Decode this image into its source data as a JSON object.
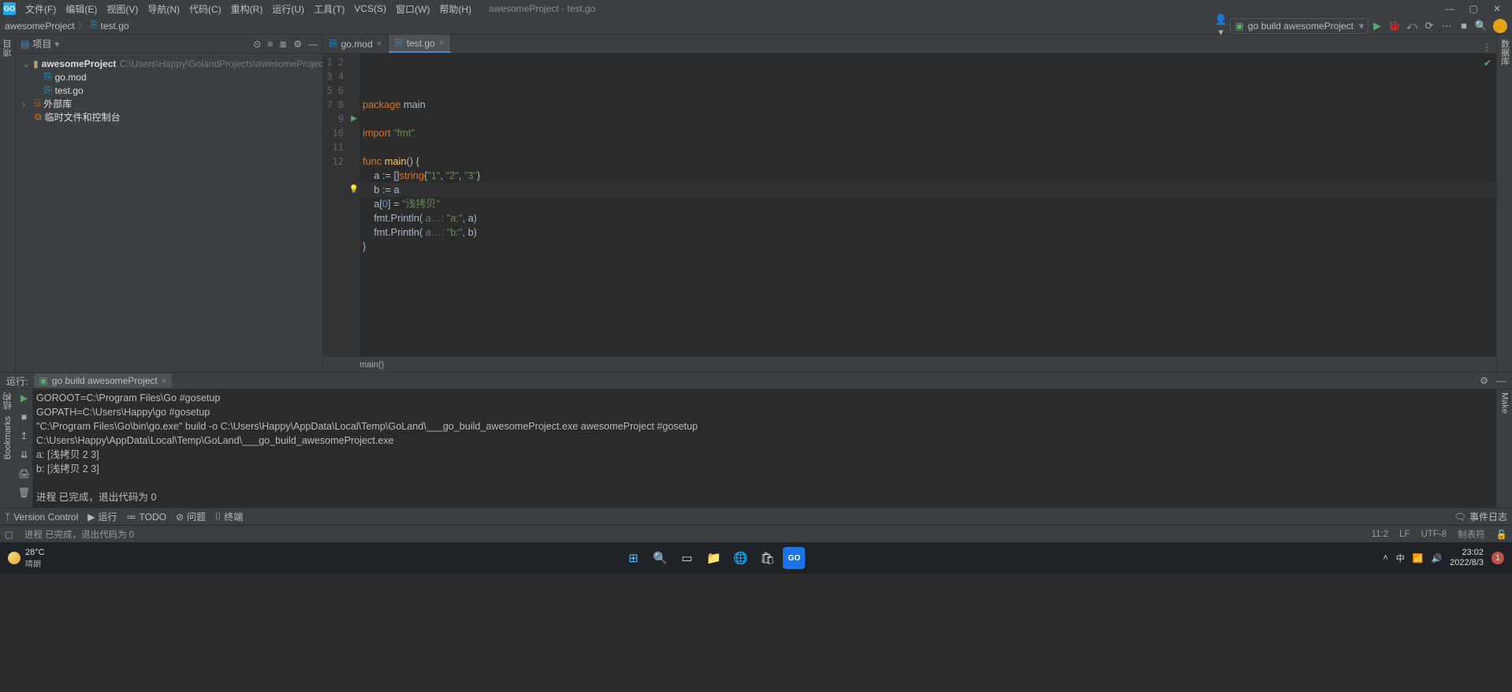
{
  "window": {
    "title": "awesomeProject - test.go",
    "menus": [
      "文件(F)",
      "编辑(E)",
      "视图(V)",
      "导航(N)",
      "代码(C)",
      "重构(R)",
      "运行(U)",
      "工具(T)",
      "VCS(S)",
      "窗口(W)",
      "帮助(H)"
    ]
  },
  "breadcrumb": {
    "project": "awesomeProject",
    "file": "test.go"
  },
  "run_config": {
    "label": "go build awesomeProject"
  },
  "project_panel": {
    "title": "项目",
    "root": {
      "name": "awesomeProject",
      "path": "C:\\Users\\Happy\\GolandProjects\\awesomeProject"
    },
    "files": [
      {
        "name": "go.mod"
      },
      {
        "name": "test.go"
      }
    ],
    "ext_lib": "外部库",
    "scratches": "临时文件和控制台"
  },
  "left_vtabs": [
    "项目"
  ],
  "right_vtabs": [
    "数据库"
  ],
  "editor": {
    "tabs": [
      {
        "name": "go.mod",
        "active": false
      },
      {
        "name": "test.go",
        "active": true
      }
    ],
    "crumb": "main()",
    "line_count": 12,
    "code": {
      "l1_kw": "package",
      "l1_id": "main",
      "l3_kw": "import",
      "l3_str": "\"fmt\"",
      "l5_kw": "func",
      "l5_fn": "main",
      "l5_rest": "() {",
      "l6": "    a := []string{\"1\", \"2\", \"3\"}",
      "l7": "    b := a",
      "l8_pre": "    a[",
      "l8_idx": "0",
      "l8_mid": "] = ",
      "l8_str": "\"浅拷贝\"",
      "l9_call": "    fmt.Println(",
      "l9_hint": " a…: ",
      "l9_str": "\"a:\"",
      "l9_end": ", a)",
      "l10_call": "    fmt.Println(",
      "l10_hint": " a…: ",
      "l10_str": "\"b:\"",
      "l10_end": ", b)",
      "l11": "}"
    }
  },
  "run_tool": {
    "title": "运行:",
    "tab": "go build awesomeProject",
    "left_vtab": "结构",
    "left_vtab2": "Bookmarks",
    "right_vtab": "Make",
    "lines": [
      "GOROOT=C:\\Program Files\\Go #gosetup",
      "GOPATH=C:\\Users\\Happy\\go #gosetup",
      "\"C:\\Program Files\\Go\\bin\\go.exe\" build -o C:\\Users\\Happy\\AppData\\Local\\Temp\\GoLand\\___go_build_awesomeProject.exe awesomeProject #gosetup",
      "C:\\Users\\Happy\\AppData\\Local\\Temp\\GoLand\\___go_build_awesomeProject.exe",
      "a: [浅拷贝 2 3]",
      "b: [浅拷贝 2 3]",
      "",
      "进程 已完成，退出代码为 0"
    ]
  },
  "bottom_tools": {
    "vcs": "Version Control",
    "run": "运行",
    "todo": "TODO",
    "problems": "问题",
    "terminal": "终端",
    "event_log": "事件日志"
  },
  "statusbar": {
    "msg": "进程 已完成，退出代码为 0",
    "pos": "11:2",
    "eol": "LF",
    "enc": "UTF-8",
    "indent": "制表符"
  },
  "taskbar": {
    "temp": "28°C",
    "cond": "晴朗",
    "ime": "中",
    "time": "23:02",
    "date": "2022/8/3"
  }
}
